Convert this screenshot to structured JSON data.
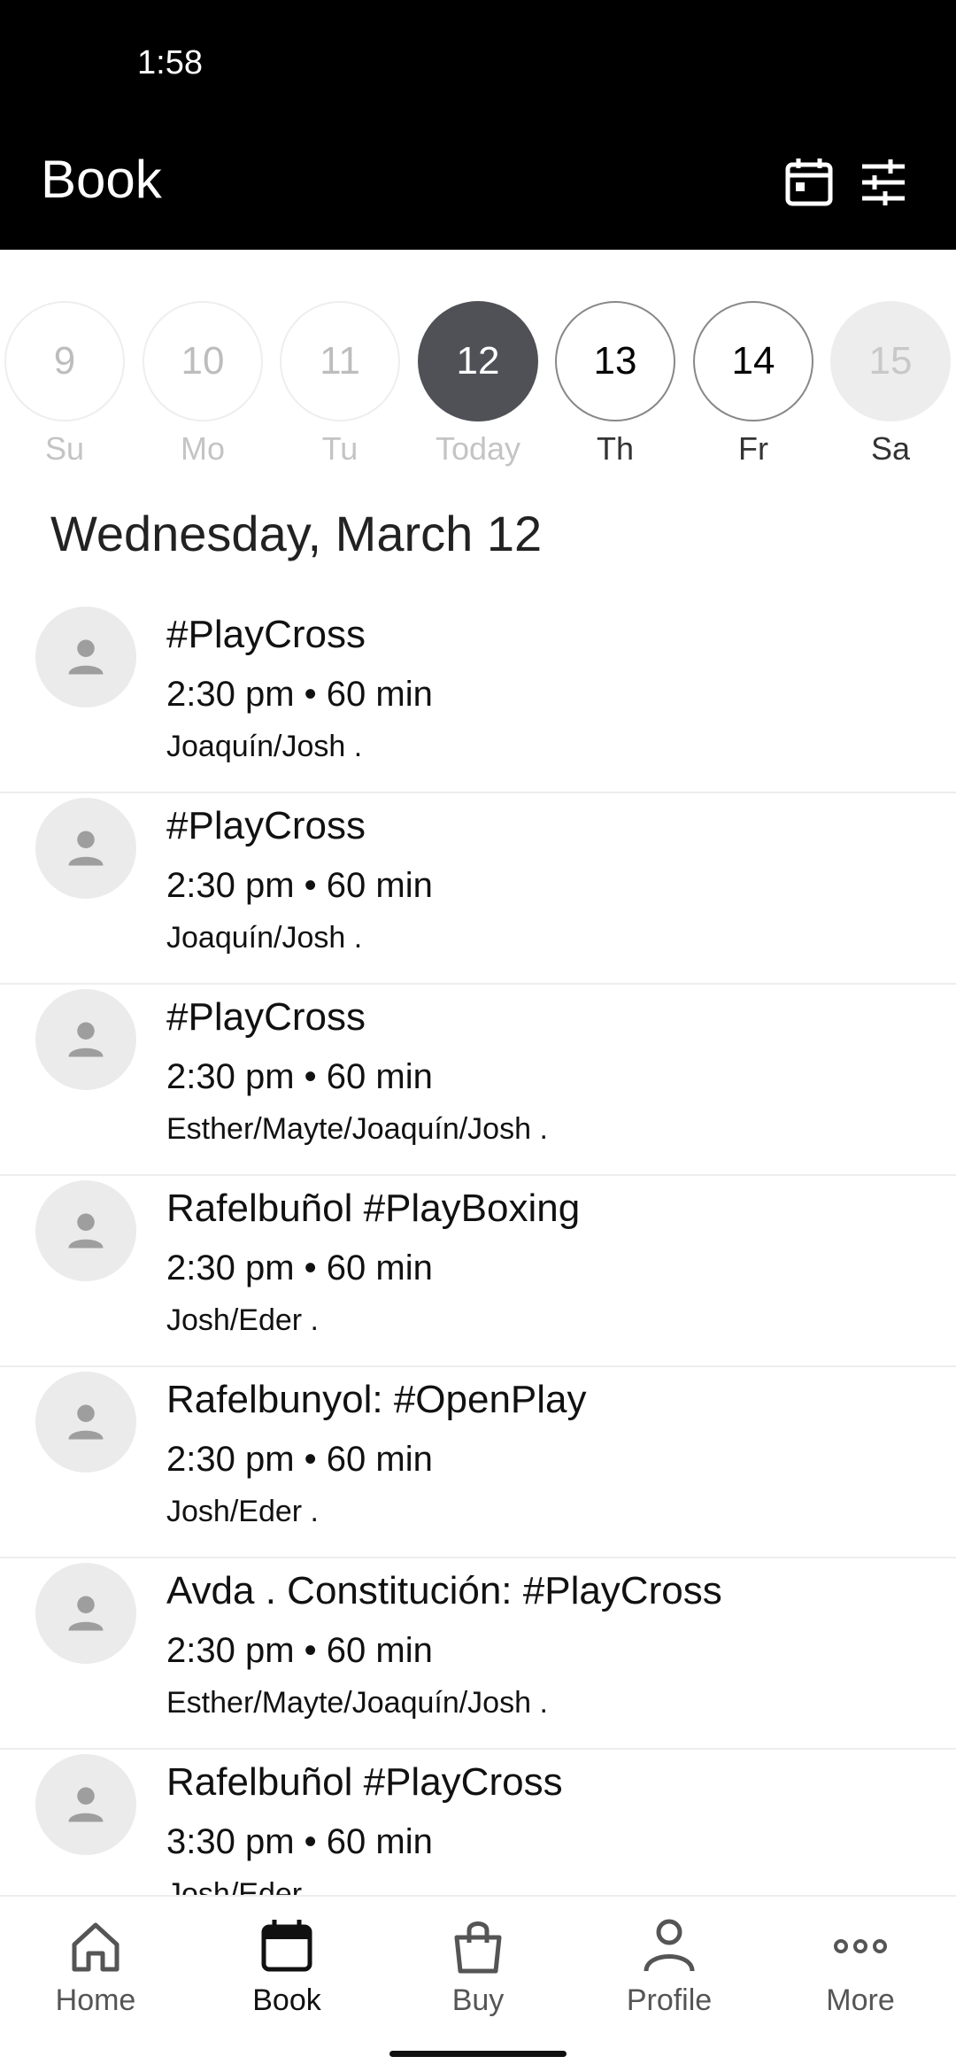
{
  "status_bar": {
    "time": "1:58"
  },
  "header": {
    "title": "Book",
    "icons": [
      "calendar-icon",
      "filter-sliders-icon"
    ]
  },
  "date_strip": {
    "days": [
      {
        "number": "9",
        "label": "Su",
        "state": "past"
      },
      {
        "number": "10",
        "label": "Mo",
        "state": "past"
      },
      {
        "number": "11",
        "label": "Tu",
        "state": "past"
      },
      {
        "number": "12",
        "label": "Today",
        "state": "today"
      },
      {
        "number": "13",
        "label": "Th",
        "state": "active"
      },
      {
        "number": "14",
        "label": "Fr",
        "state": "active"
      },
      {
        "number": "15",
        "label": "Sa",
        "state": "unavailable"
      }
    ]
  },
  "date_heading": "Wednesday, March 12",
  "classes": [
    {
      "title": "#PlayCross",
      "time": "2:30 pm • 60 min",
      "people": "Joaquín/Josh ."
    },
    {
      "title": "#PlayCross",
      "time": "2:30 pm • 60 min",
      "people": "Joaquín/Josh ."
    },
    {
      "title": "#PlayCross",
      "time": "2:30 pm • 60 min",
      "people": "Esther/Mayte/Joaquín/Josh ."
    },
    {
      "title": "Rafelbuñol #PlayBoxing",
      "time": "2:30 pm • 60 min",
      "people": "Josh/Eder ."
    },
    {
      "title": "Rafelbunyol: #OpenPlay",
      "time": "2:30 pm • 60 min",
      "people": "Josh/Eder ."
    },
    {
      "title": "Avda . Constitución: #PlayCross",
      "time": "2:30 pm • 60 min",
      "people": "Esther/Mayte/Joaquín/Josh ."
    },
    {
      "title": "Rafelbuñol #PlayCross",
      "time": "3:30 pm • 60 min",
      "people": "Josh/Eder ."
    }
  ],
  "bottom_nav": {
    "items": [
      {
        "label": "Home",
        "icon": "home-icon"
      },
      {
        "label": "Book",
        "icon": "calendar-icon",
        "selected": true
      },
      {
        "label": "Buy",
        "icon": "shopping-bag-icon"
      },
      {
        "label": "Profile",
        "icon": "person-icon"
      },
      {
        "label": "More",
        "icon": "more-dots-icon"
      }
    ]
  },
  "colors": {
    "header_bg": "#000000",
    "today_circle": "#505157",
    "avatar_bg": "#ebebeb"
  }
}
